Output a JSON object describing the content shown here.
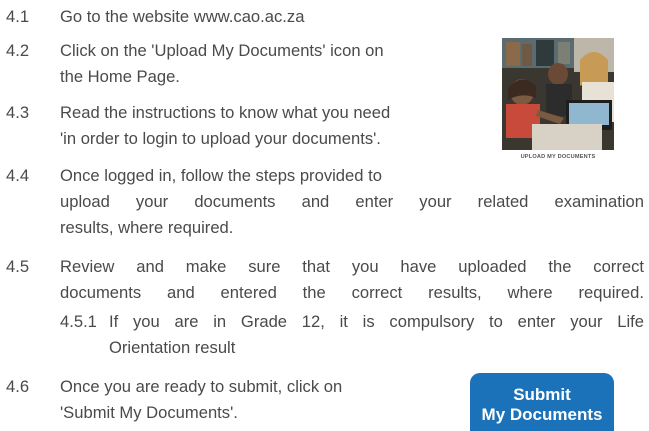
{
  "steps": [
    {
      "num": "4.1",
      "lines": [
        "Go to the website www.cao.ac.za"
      ]
    },
    {
      "num": "4.2",
      "lines": [
        "Click on the 'Upload My Documents' icon on",
        "the Home Page."
      ]
    },
    {
      "num": "4.3",
      "lines": [
        "Read the instructions to know what you need",
        "'in order to login to upload your documents'."
      ]
    },
    {
      "num": "4.4",
      "lines": [
        "Once logged in, follow the steps provided to",
        "upload your documents and enter your related examination",
        "results, where required."
      ]
    },
    {
      "num": "4.5",
      "lines": [
        "Review and make sure that you have uploaded the correct",
        "documents and entered the correct results, where required."
      ]
    },
    {
      "num": "4.5.1",
      "lines": [
        "If you are in Grade 12, it is compulsory to enter your Life",
        "Orientation result"
      ]
    },
    {
      "num": "4.6",
      "lines": [
        "Once you are ready to submit, click on",
        "'Submit My Documents'."
      ]
    }
  ],
  "image": {
    "caption": "UPLOAD MY DOCUMENTS"
  },
  "submit_button": {
    "line1": "Submit",
    "line2": "My Documents",
    "color": "#1b72b8"
  }
}
